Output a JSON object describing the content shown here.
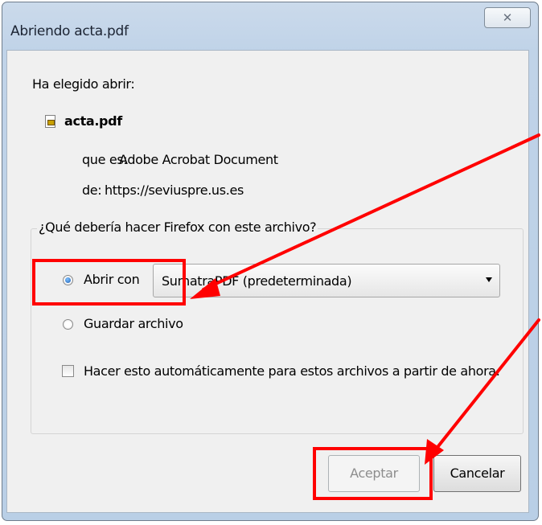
{
  "window": {
    "title": "Abriendo acta.pdf",
    "close_glyph": "✕"
  },
  "dialog": {
    "intro": "Ha elegido abrir:",
    "file_name": "acta.pdf",
    "type_label": "que es:",
    "type_value": "Adobe Acrobat Document",
    "from_label": "de:",
    "from_value": "https://seviuspre.us.es",
    "group_caption": "¿Qué debería hacer Firefox con este archivo?"
  },
  "options": {
    "open_with_label": "Abrir con",
    "open_with_selected": true,
    "app_select_value": "SumatraPDF (predeterminada)",
    "save_label": "Guardar archivo",
    "save_selected": false,
    "remember_label": "Hacer esto automáticamente para estos archivos a partir de ahora.",
    "remember_checked": false
  },
  "buttons": {
    "accept_label": "Aceptar",
    "cancel_label": "Cancelar"
  },
  "icons": {
    "file": "pdf-file-icon",
    "close": "close-icon",
    "dropdown": "chevron-down-icon"
  },
  "colors": {
    "annotation": "#ff0000",
    "radio_selected": "#1f5fb3"
  }
}
